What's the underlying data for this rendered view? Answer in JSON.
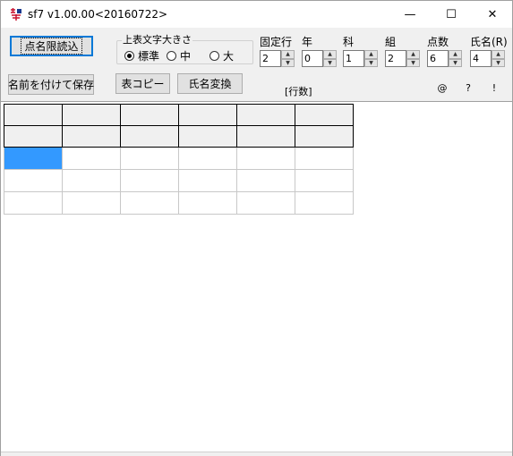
{
  "window": {
    "title": "sf7 v1.00.00<20160722>",
    "controls": {
      "minimize": "—",
      "maximize": "☐",
      "close": "✕"
    }
  },
  "toolbar": {
    "load_button": "点名限読込",
    "save_as_button": "名前を付けて保存",
    "copy_table_button": "表コピー",
    "name_convert_button": "氏名変換",
    "font_size_group": {
      "legend": "上表文字大きさ",
      "options": [
        "標準",
        "中",
        "大"
      ],
      "selected": "標準"
    },
    "spinners": [
      {
        "label": "固定行",
        "value": "2"
      },
      {
        "label": "年",
        "value": "0"
      },
      {
        "label": "科",
        "value": "1"
      },
      {
        "label": "組",
        "value": "2"
      },
      {
        "label": "点数",
        "value": "6"
      },
      {
        "label": "氏名(R)",
        "value": "4"
      }
    ],
    "row_count_label": "[行数]",
    "symbols": [
      "@",
      "?",
      "!"
    ]
  },
  "grid": {
    "columns": 6,
    "fixed_rows": 2,
    "data_rows": 3,
    "selected_cell": {
      "row": 0,
      "col": 0
    }
  }
}
